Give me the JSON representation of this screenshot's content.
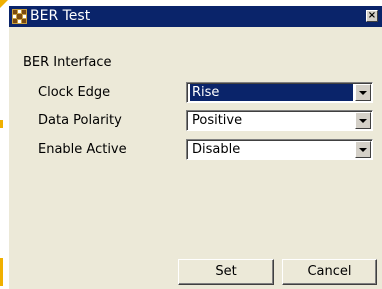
{
  "window": {
    "title": "BER Test",
    "close_glyph": "×"
  },
  "form": {
    "section_title": "BER Interface",
    "rows": [
      {
        "label": "Clock Edge",
        "value": "Rise"
      },
      {
        "label": "Data Polarity",
        "value": "Positive"
      },
      {
        "label": "Enable Active",
        "value": "Disable"
      }
    ]
  },
  "buttons": {
    "set_label": "Set",
    "cancel_label": "Cancel"
  },
  "colors": {
    "titlebar": "#0a246a",
    "dialog_face": "#ece9d8",
    "selection": "#0a246a"
  },
  "icons": [
    "app-icon",
    "close-icon",
    "chevron-down-icon"
  ]
}
